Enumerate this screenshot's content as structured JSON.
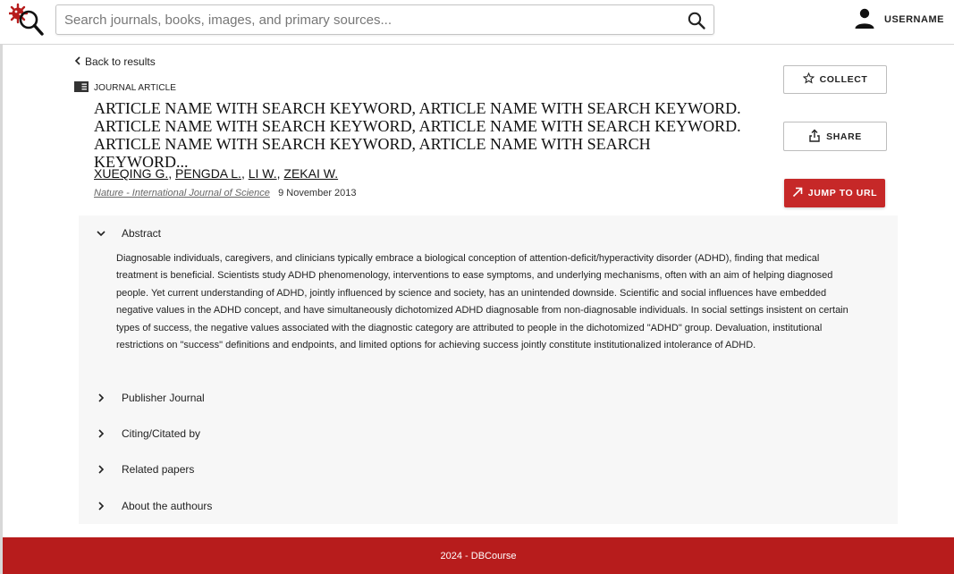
{
  "header": {
    "search_placeholder": "Search journals, books, images, and primary sources...",
    "username": "USERNAME",
    "logo_icon": "virus-magnifier-logo-icon",
    "search_icon": "search-icon",
    "user_icon": "user-icon"
  },
  "article": {
    "back_label": "Back to results",
    "type_label": "JOURNAL ARTICLE",
    "title": "ARTICLE NAME WITH SEARCH KEYWORD, ARTICLE NAME WITH SEARCH KEYWORD. ARTICLE NAME WITH SEARCH KEYWORD, ARTICLE NAME WITH SEARCH KEYWORD. ARTICLE NAME WITH SEARCH KEYWORD, ARTICLE NAME WITH SEARCH KEYWORD...",
    "authors": [
      "XUEQING G.",
      "PENGDA L.",
      "LI W.",
      "ZEKAI W."
    ],
    "journal": "Nature - International Journal of Science",
    "date": "9 November 2013"
  },
  "actions": {
    "collect_label": "COLLECT",
    "share_label": "SHARE",
    "jump_label": "JUMP TO URL"
  },
  "sections": {
    "abstract_label": "Abstract",
    "abstract_text": "Diagnosable individuals, caregivers, and clinicians typically embrace a biological conception of attention-deficit/hyperactivity disorder (ADHD), finding that medical treatment is beneficial. Scientists study ADHD phenomenology, interventions to ease symptoms, and underlying mechanisms, often with an aim of helping diagnosed people. Yet current understanding of ADHD, jointly influenced by science and society, has an unintended downside. Scientific and social influences have embedded negative values in the ADHD concept, and have simultaneously dichotomized ADHD diagnosable from non-diagnosable individuals. In social settings insistent on certain types of success, the negative values associated with the diagnostic category are attributed to people in the dichotomized \"ADHD\" group. Devaluation, institutional restrictions on \"success\" definitions and endpoints, and limited options for achieving success jointly constitute institutionalized intolerance of ADHD.",
    "publisher_label": "Publisher Journal",
    "citing_label": "Citing/Citated by",
    "related_label": "Related papers",
    "about_label": "About the authours"
  },
  "footer": {
    "text": "2024 - DBCourse"
  },
  "colors": {
    "accent": "#c62828",
    "footer": "#b71c1c",
    "panel_bg": "#f7f7f7"
  }
}
